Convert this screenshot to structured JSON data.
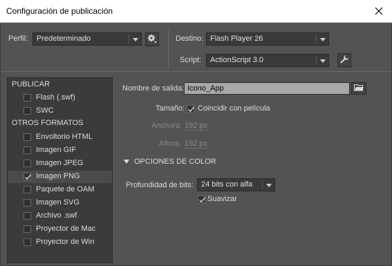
{
  "window": {
    "title": "Configuración de publicación"
  },
  "header": {
    "profile_label": "Perfil:",
    "profile_value": "Predeterminado",
    "target_label": "Destino:",
    "target_value": "Flash Player 26",
    "script_label": "Script:",
    "script_value": "ActionScript 3.0"
  },
  "sidebar": {
    "publish_heading": "PUBLICAR",
    "publish_items": [
      {
        "label": "Flash (.swf)",
        "checked": false
      },
      {
        "label": "SWC",
        "checked": false
      }
    ],
    "other_heading": "OTROS FORMATOS",
    "other_items": [
      {
        "label": "Envoltorio HTML",
        "checked": false
      },
      {
        "label": "Imagen GIF",
        "checked": false
      },
      {
        "label": "Imagen JPEG",
        "checked": false
      },
      {
        "label": "Imagen PNG",
        "checked": true,
        "selected": true
      },
      {
        "label": "Paquete de OAM",
        "checked": false
      },
      {
        "label": "Imagen SVG",
        "checked": false
      },
      {
        "label": "Archivo .swf",
        "checked": false
      },
      {
        "label": "Proyector de Mac",
        "checked": false
      },
      {
        "label": "Proyector de Win",
        "checked": false
      }
    ]
  },
  "main": {
    "output_label": "Nombre de salida:",
    "output_value": "Icono_App",
    "size_label": "Tamaño:",
    "match_movie_label": "Coincidir con película",
    "match_movie_checked": true,
    "width_label": "Anchura:",
    "width_value": "192 px",
    "height_label": "Altura:",
    "height_value": "192 px",
    "color_section_label": "OPCIONES DE COLOR",
    "bit_depth_label": "Profundidad de bits:",
    "bit_depth_value": "24 bits con alfa",
    "smooth_label": "Suavizar",
    "smooth_checked": true
  }
}
